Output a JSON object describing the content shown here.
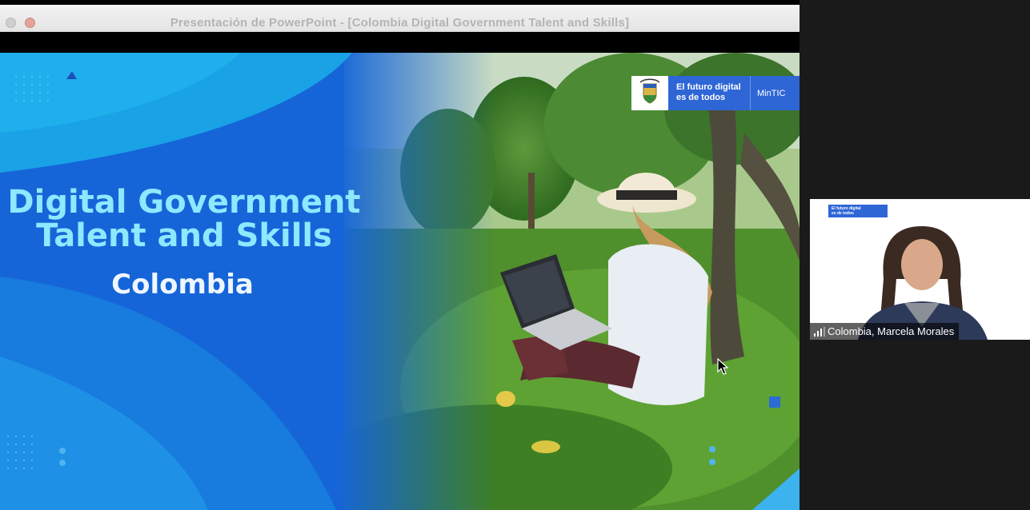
{
  "window": {
    "title": "Presentación de PowerPoint - [Colombia Digital Government Talent and Skills]"
  },
  "slide": {
    "title_line1": "Digital Government",
    "title_line2": "Talent and Skills",
    "subtitle": "Colombia",
    "brand_text": "El futuro digital\nes de todos",
    "brand_ministry": "MinTIC",
    "colors": {
      "background_blue": "#1565d8",
      "title_cyan": "#8ee8ff",
      "brand_blue": "#2e66d6"
    }
  },
  "participant": {
    "name": "Colombia, Marcela Morales",
    "background_brand_text": "El futuro digital\nes de todos",
    "signal_icon": "signal-bars-icon"
  }
}
